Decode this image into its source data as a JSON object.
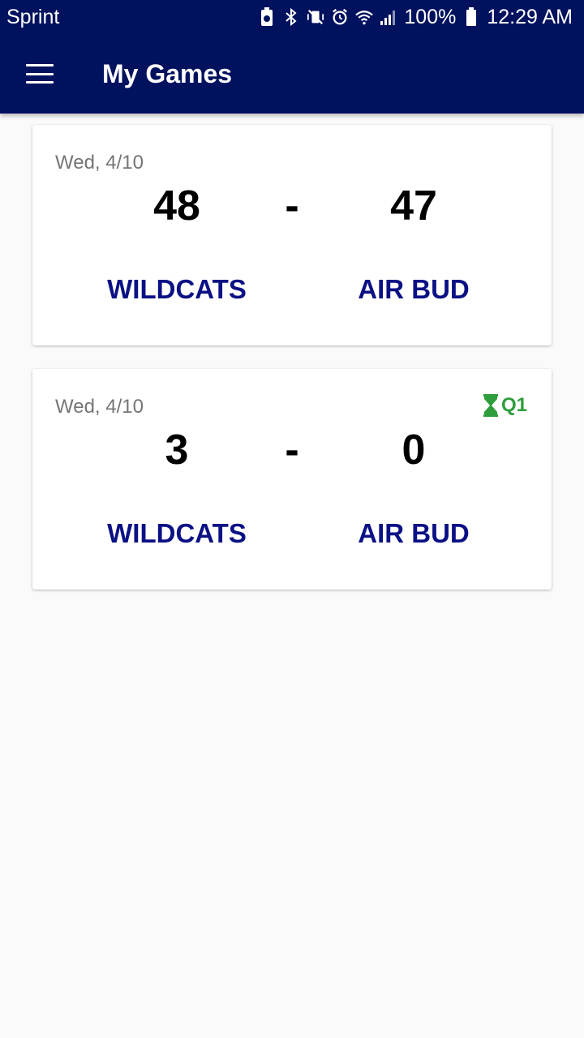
{
  "status_bar": {
    "carrier": "Sprint",
    "battery": "100%",
    "time": "12:29 AM"
  },
  "app_bar": {
    "title": "My Games"
  },
  "games": [
    {
      "date": "Wed, 4/10",
      "home_score": "48",
      "separator": "-",
      "away_score": "47",
      "home_team": "WILDCATS",
      "away_team": "AIR BUD",
      "period": ""
    },
    {
      "date": "Wed, 4/10",
      "home_score": "3",
      "separator": "-",
      "away_score": "0",
      "home_team": "WILDCATS",
      "away_team": "AIR BUD",
      "period": "Q1",
      "period_icon": "hourglass-icon"
    }
  ],
  "colors": {
    "primary": "#00115e",
    "team_text": "#0b1184",
    "live_indicator": "#2e9e3c",
    "background": "#fafafa"
  }
}
